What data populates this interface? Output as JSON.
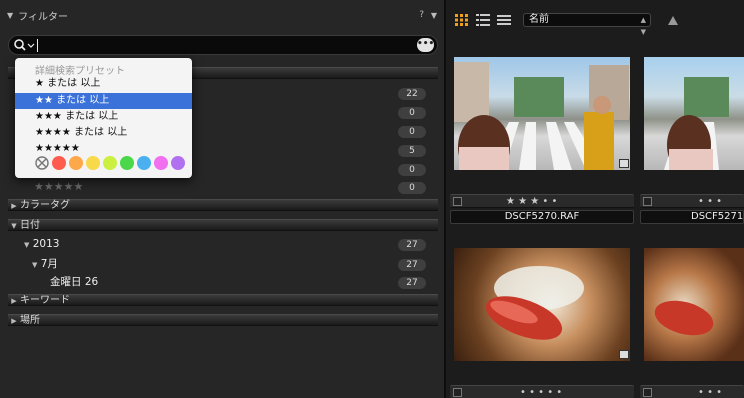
{
  "filter_panel": {
    "title": "フィルター",
    "help_icon": "?",
    "collapse_icon": "▼"
  },
  "search": {
    "value": "",
    "more_label": "•••"
  },
  "presets_menu": {
    "header": "詳細検索プリセット",
    "items": [
      {
        "label": "★ または 以上",
        "selected": false
      },
      {
        "label": "★★ または 以上",
        "selected": true
      },
      {
        "label": "★★★ または 以上",
        "selected": false
      },
      {
        "label": "★★★★ または 以上",
        "selected": false
      },
      {
        "label": "★★★★★",
        "selected": false
      }
    ],
    "color_swatches": [
      "#ff5b4f",
      "#ffa84a",
      "#f7d94a",
      "#ccf040",
      "#4ad84a",
      "#4ab0f0",
      "#f070f0",
      "#b070f0"
    ]
  },
  "rating_rows": [
    {
      "stars": "",
      "count": "22"
    },
    {
      "stars": "",
      "count": "0"
    },
    {
      "stars": "",
      "count": "0"
    },
    {
      "stars": "",
      "count": "5"
    },
    {
      "stars": "",
      "count": "0"
    },
    {
      "stars": "★★★★★",
      "count": "0"
    }
  ],
  "sections": {
    "color_tag": "カラータグ",
    "date": "日付",
    "keyword": "キーワード",
    "place": "場所"
  },
  "date_tree": [
    {
      "label": "2013",
      "count": "27"
    },
    {
      "label": "7月",
      "count": "27"
    },
    {
      "label": "金曜日 26",
      "count": "27"
    }
  ],
  "browser": {
    "sort_label": "名前",
    "thumbnails": [
      {
        "name": "DSCF5270.RAF",
        "rating": "★ ★ ★ • •"
      },
      {
        "name": "DSCF5271",
        "rating": "• • •"
      },
      {
        "name": "",
        "rating": "• • • • •"
      },
      {
        "name": "",
        "rating": "• • •"
      }
    ]
  }
}
